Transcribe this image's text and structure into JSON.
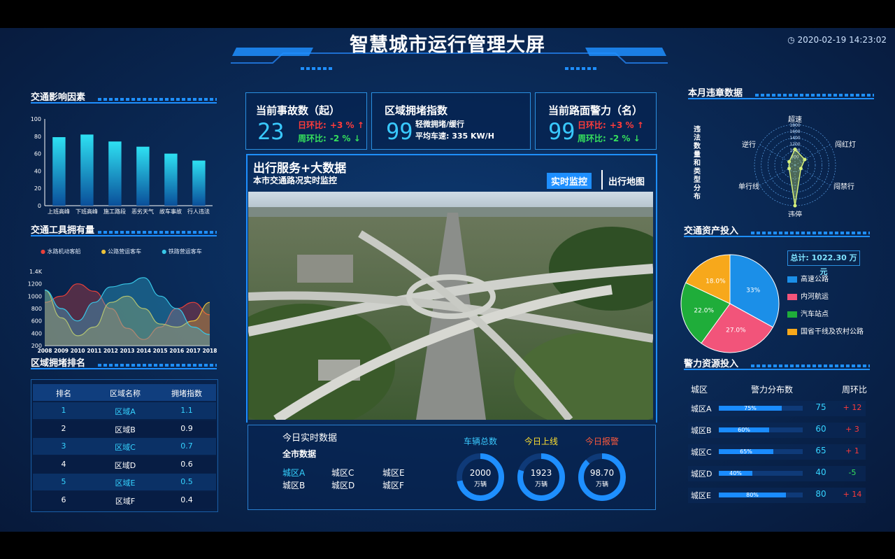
{
  "header": {
    "title": "智慧城市运行管理大屏",
    "datetime": "2020-02-19 14:23:02"
  },
  "left": {
    "traffic_factors": {
      "title": "交通影响因素"
    },
    "vehicle_ownership": {
      "title": "交通工具拥有量",
      "legend": [
        "水路机动客船",
        "公路营运客车",
        "铁路营运客车"
      ]
    },
    "congestion_rank": {
      "title": "区域拥堵排名",
      "headers": [
        "排名",
        "区域名称",
        "拥堵指数"
      ],
      "rows": [
        {
          "rank": "1",
          "name": "区域A",
          "index": "1.1"
        },
        {
          "rank": "2",
          "name": "区域B",
          "index": "0.9"
        },
        {
          "rank": "3",
          "name": "区域C",
          "index": "0.7"
        },
        {
          "rank": "4",
          "name": "区域D",
          "index": "0.6"
        },
        {
          "rank": "5",
          "name": "区域E",
          "index": "0.5"
        },
        {
          "rank": "6",
          "name": "区域F",
          "index": "0.4"
        }
      ]
    }
  },
  "kpis": [
    {
      "title": "当前事故数（起）",
      "value": "23",
      "day_label": "日环比:",
      "day_val": "+3 % ↑",
      "week_label": "周环比:",
      "week_val": "-2 % ↓"
    },
    {
      "title": "区域拥堵指数",
      "value": "99",
      "line1": "轻微拥堵/缓行",
      "line2": "平均车速: 335 KW/H"
    },
    {
      "title": "当前路面警力（名）",
      "value": "99",
      "day_label": "日环比:",
      "day_val": "+3 % ↑",
      "week_label": "周环比:",
      "week_val": "-2 % ↓"
    }
  ],
  "center": {
    "title": "出行服务+大数据",
    "subtitle": "本市交通路况实时监控",
    "tab_active": "实时监控",
    "tab_inactive": "出行地图"
  },
  "realtime": {
    "title": "今日实时数据",
    "subtitle": "全市数据",
    "areas": [
      "城区A",
      "城区C",
      "城区E",
      "城区B",
      "城区D",
      "城区F"
    ],
    "rings": [
      {
        "label": "车辆总数",
        "value": "2000",
        "unit": "万辆",
        "color": "#39c9ff",
        "fill": 0.72
      },
      {
        "label": "今日上线",
        "value": "1923",
        "unit": "万辆",
        "color": "#ffe030",
        "fill": 0.8
      },
      {
        "label": "今日报警",
        "value": "98.70",
        "unit": "万辆",
        "color": "#ff5a3c",
        "fill": 0.88
      }
    ]
  },
  "right": {
    "violations": {
      "title": "本月违章数据",
      "side_label": "违法数量和类型分布",
      "axes": [
        "超速",
        "闯红灯",
        "闯禁行",
        "违停",
        "单行线",
        "逆行"
      ],
      "ticks": [
        "1800",
        "1600",
        "1400",
        "1200",
        "1000",
        "800"
      ]
    },
    "assets": {
      "title": "交通资产投入",
      "total_label": "总计:",
      "total_value": "1022.30 万元",
      "legend": [
        {
          "name": "高速公路",
          "color": "#1b8fe8"
        },
        {
          "name": "内河航运",
          "color": "#f2547a"
        },
        {
          "name": "汽车站点",
          "color": "#1fad3a"
        },
        {
          "name": "国省干线及农村公路",
          "color": "#f7a81b"
        }
      ]
    },
    "police": {
      "title": "警力资源投入",
      "headers": [
        "城区",
        "警力分布数",
        "周环比"
      ],
      "rows": [
        {
          "area": "城区A",
          "pct": "75%",
          "num": "75",
          "chg": "+ 12"
        },
        {
          "area": "城区B",
          "pct": "60%",
          "num": "60",
          "chg": "+ 3"
        },
        {
          "area": "城区C",
          "pct": "65%",
          "num": "65",
          "chg": "+ 1"
        },
        {
          "area": "城区D",
          "pct": "40%",
          "num": "40",
          "chg": "-5"
        },
        {
          "area": "城区E",
          "pct": "80%",
          "num": "80",
          "chg": "+ 14"
        }
      ]
    }
  },
  "chart_data": [
    {
      "type": "bar",
      "title": "交通影响因素",
      "categories": [
        "上班高峰",
        "下班高峰",
        "施工路段",
        "恶劣天气",
        "故车事故",
        "行人违法"
      ],
      "values": [
        79,
        82,
        74,
        68,
        60,
        52
      ],
      "ylim": [
        0,
        100
      ],
      "yticks": [
        "0",
        "20",
        "40",
        "60",
        "80",
        "100"
      ]
    },
    {
      "type": "area",
      "title": "交通工具拥有量",
      "x": [
        "2008",
        "2009",
        "2010",
        "2011",
        "2012",
        "2013",
        "2014",
        "2015",
        "2016",
        "2017",
        "2018"
      ],
      "ylim": [
        200,
        1400
      ],
      "yticks": [
        "200",
        "400",
        "600",
        "800",
        "1000",
        "1200",
        "1.4K"
      ],
      "series": [
        {
          "name": "水路机动客船",
          "color": "#e8403a",
          "values": [
            900,
            1000,
            1200,
            1080,
            800,
            480,
            300,
            500,
            800,
            900,
            700
          ]
        },
        {
          "name": "公路营运客车",
          "color": "#ecc23a",
          "values": [
            1100,
            650,
            360,
            500,
            900,
            1000,
            800,
            550,
            500,
            600,
            900
          ]
        },
        {
          "name": "铁路营运客车",
          "color": "#38c8e8",
          "values": [
            1100,
            800,
            600,
            900,
            1150,
            1200,
            1300,
            1000,
            800,
            500,
            380
          ]
        }
      ]
    },
    {
      "type": "pie",
      "title": "交通资产投入",
      "labels": [
        "高速公路",
        "内河航运",
        "汽车站点",
        "国省干线及农村公路"
      ],
      "values": [
        33,
        27,
        22,
        18
      ],
      "display": [
        "33%",
        "27.0%",
        "22.0%",
        "18.0%"
      ]
    },
    {
      "type": "radar",
      "title": "本月违章数据",
      "axes": [
        "超速",
        "闯红灯",
        "闯禁行",
        "违停",
        "单行线",
        "逆行"
      ],
      "values": [
        700,
        500,
        300,
        1800,
        300,
        300
      ],
      "max": 1800
    }
  ]
}
